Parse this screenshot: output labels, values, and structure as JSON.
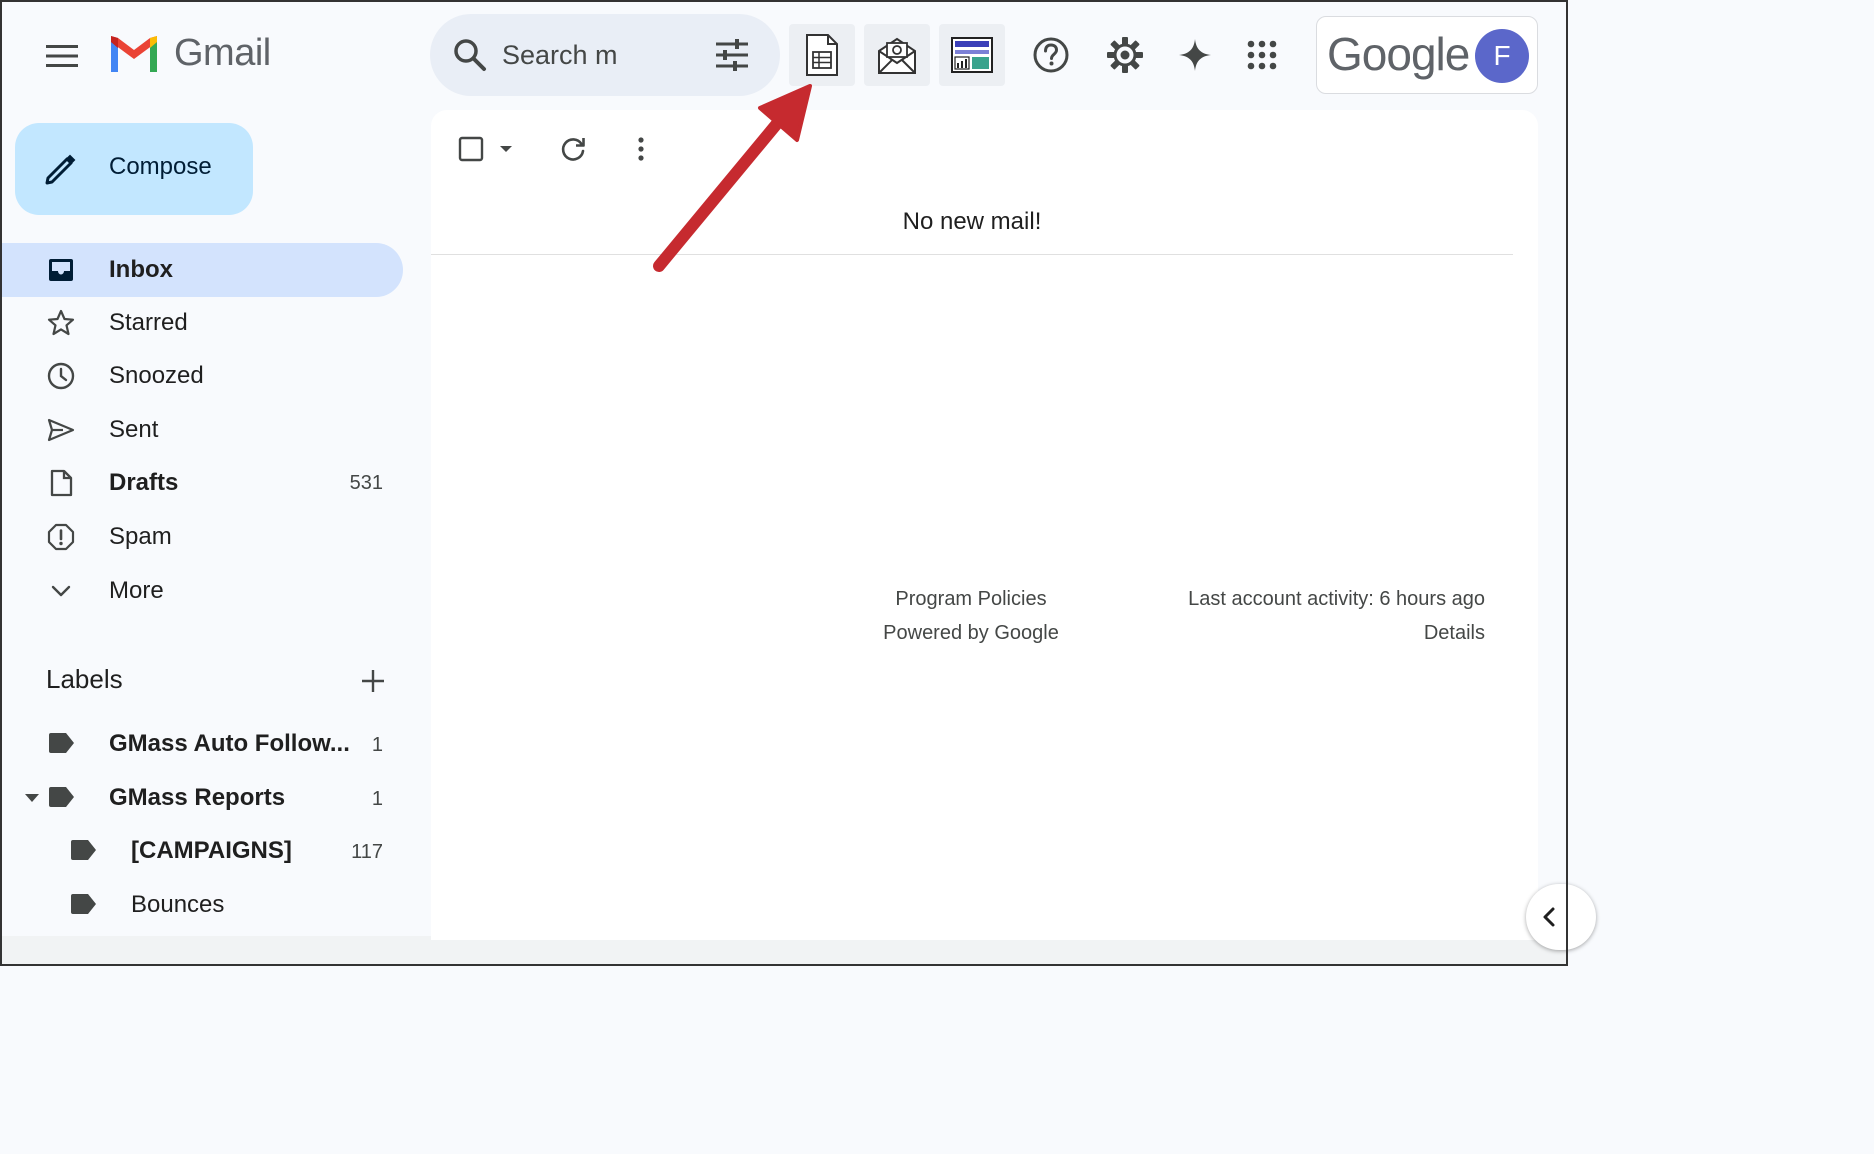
{
  "header": {
    "app_name": "Gmail",
    "search": {
      "placeholder": "Search m"
    },
    "account": {
      "brand": "Google",
      "avatar_letter": "F",
      "avatar_color": "#5b67ca"
    }
  },
  "sidebar": {
    "compose_label": "Compose",
    "items": [
      {
        "label": "Inbox",
        "icon": "inbox-icon",
        "active": true,
        "bold": true
      },
      {
        "label": "Starred",
        "icon": "star-icon"
      },
      {
        "label": "Snoozed",
        "icon": "clock-icon"
      },
      {
        "label": "Sent",
        "icon": "send-icon"
      },
      {
        "label": "Drafts",
        "icon": "draft-icon",
        "bold": true,
        "count": "531"
      },
      {
        "label": "Spam",
        "icon": "spam-icon"
      },
      {
        "label": "More",
        "icon": "chevron-down-icon"
      }
    ],
    "labels_heading": "Labels",
    "labels": [
      {
        "name": "GMass Auto Follow...",
        "count": "1",
        "bold": true
      },
      {
        "name": "GMass Reports",
        "count": "1",
        "bold": true
      },
      {
        "name": "[CAMPAIGNS]",
        "count": "117",
        "bold": true
      },
      {
        "name": "Bounces",
        "count": ""
      }
    ]
  },
  "main": {
    "empty_message": "No new mail!",
    "footer": {
      "program_policies": "Program Policies",
      "powered_by": "Powered by Google",
      "last_activity": "Last account activity: 6 hours ago",
      "details": "Details"
    }
  },
  "colors": {
    "active_nav": "#d3e3fd",
    "compose_bg": "#c2e7ff",
    "annotation_arrow": "#c62a2f"
  }
}
